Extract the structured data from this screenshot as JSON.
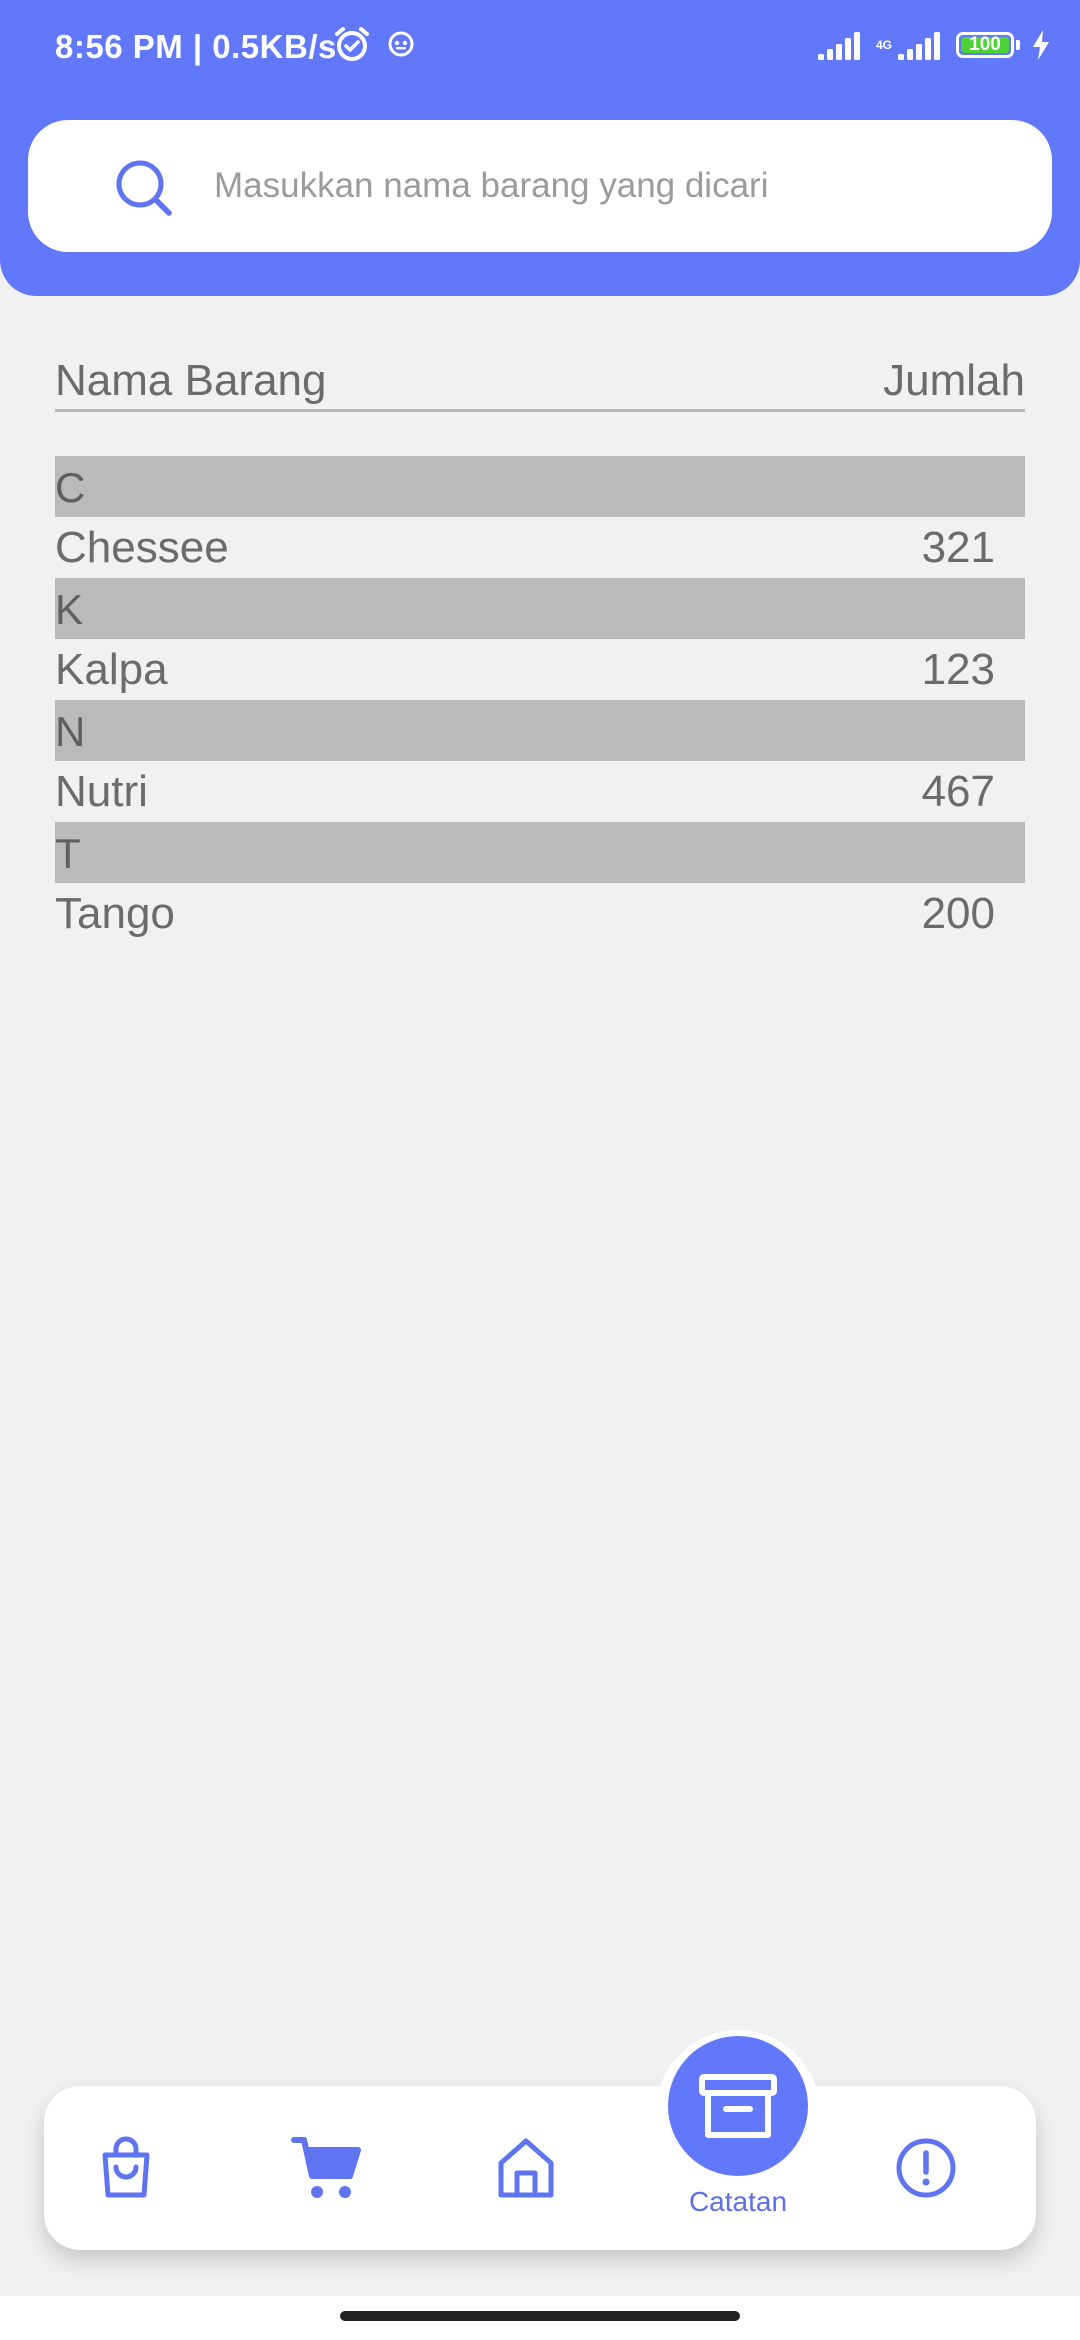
{
  "status_bar": {
    "time_speed": "8:56 PM | 0.5KB/s",
    "network_label": "4G",
    "battery": "100"
  },
  "search": {
    "placeholder": "Masukkan nama barang yang dicari",
    "value": ""
  },
  "table": {
    "col_name": "Nama Barang",
    "col_qty": "Jumlah"
  },
  "sections": [
    {
      "letter": "C",
      "item": {
        "name": "Chessee",
        "qty": "321"
      }
    },
    {
      "letter": "K",
      "item": {
        "name": "Kalpa",
        "qty": "123"
      }
    },
    {
      "letter": "N",
      "item": {
        "name": "Nutri",
        "qty": "467"
      }
    },
    {
      "letter": "T",
      "item": {
        "name": "Tango",
        "qty": "200"
      }
    }
  ],
  "nav": {
    "active_label": "Catatan",
    "items": [
      "shopping-bag-icon",
      "cart-icon",
      "home-icon",
      "archive-box-icon",
      "info-alert-icon"
    ]
  },
  "colors": {
    "primary": "#6178fb",
    "background": "#f1f1f1",
    "section_header": "#bababa"
  }
}
